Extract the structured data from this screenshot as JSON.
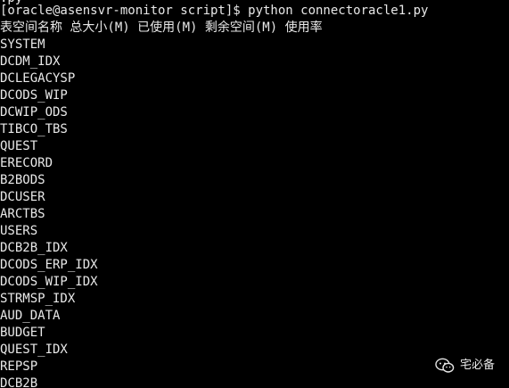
{
  "terminal": {
    "clipped_top": ".py",
    "prompt": "[oracle@asensvr-monitor script]$ python connectoracle1.py",
    "header": "表空间名称 总大小(M) 已使用(M) 剩余空间(M) 使用率",
    "tablespaces": [
      "SYSTEM",
      "DCDM_IDX",
      "DCLEGACYSP",
      "DCODS_WIP",
      "DCWIP_ODS",
      "TIBCO_TBS",
      "QUEST",
      "ERECORD",
      "B2BODS",
      "DCUSER",
      "ARCTBS",
      "USERS",
      "DCB2B_IDX",
      "DCODS_ERP_IDX",
      "DCODS_WIP_IDX",
      "STRMSP_IDX",
      "AUD_DATA",
      "BUDGET",
      "QUEST_IDX",
      "REPSP",
      "DCB2B"
    ]
  },
  "watermark": {
    "text": "宅必备",
    "icon": "wechat-icon"
  }
}
